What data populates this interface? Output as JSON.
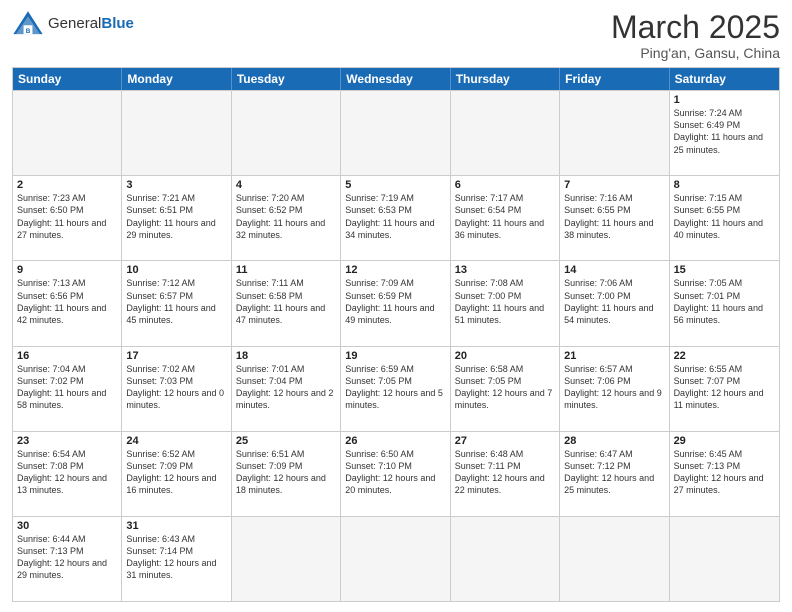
{
  "header": {
    "logo_general": "General",
    "logo_blue": "Blue",
    "month_title": "March 2025",
    "subtitle": "Ping'an, Gansu, China"
  },
  "weekdays": [
    "Sunday",
    "Monday",
    "Tuesday",
    "Wednesday",
    "Thursday",
    "Friday",
    "Saturday"
  ],
  "rows": [
    [
      {
        "day": "",
        "text": ""
      },
      {
        "day": "",
        "text": ""
      },
      {
        "day": "",
        "text": ""
      },
      {
        "day": "",
        "text": ""
      },
      {
        "day": "",
        "text": ""
      },
      {
        "day": "",
        "text": ""
      },
      {
        "day": "1",
        "text": "Sunrise: 7:24 AM\nSunset: 6:49 PM\nDaylight: 11 hours and 25 minutes."
      }
    ],
    [
      {
        "day": "2",
        "text": "Sunrise: 7:23 AM\nSunset: 6:50 PM\nDaylight: 11 hours and 27 minutes."
      },
      {
        "day": "3",
        "text": "Sunrise: 7:21 AM\nSunset: 6:51 PM\nDaylight: 11 hours and 29 minutes."
      },
      {
        "day": "4",
        "text": "Sunrise: 7:20 AM\nSunset: 6:52 PM\nDaylight: 11 hours and 32 minutes."
      },
      {
        "day": "5",
        "text": "Sunrise: 7:19 AM\nSunset: 6:53 PM\nDaylight: 11 hours and 34 minutes."
      },
      {
        "day": "6",
        "text": "Sunrise: 7:17 AM\nSunset: 6:54 PM\nDaylight: 11 hours and 36 minutes."
      },
      {
        "day": "7",
        "text": "Sunrise: 7:16 AM\nSunset: 6:55 PM\nDaylight: 11 hours and 38 minutes."
      },
      {
        "day": "8",
        "text": "Sunrise: 7:15 AM\nSunset: 6:55 PM\nDaylight: 11 hours and 40 minutes."
      }
    ],
    [
      {
        "day": "9",
        "text": "Sunrise: 7:13 AM\nSunset: 6:56 PM\nDaylight: 11 hours and 42 minutes."
      },
      {
        "day": "10",
        "text": "Sunrise: 7:12 AM\nSunset: 6:57 PM\nDaylight: 11 hours and 45 minutes."
      },
      {
        "day": "11",
        "text": "Sunrise: 7:11 AM\nSunset: 6:58 PM\nDaylight: 11 hours and 47 minutes."
      },
      {
        "day": "12",
        "text": "Sunrise: 7:09 AM\nSunset: 6:59 PM\nDaylight: 11 hours and 49 minutes."
      },
      {
        "day": "13",
        "text": "Sunrise: 7:08 AM\nSunset: 7:00 PM\nDaylight: 11 hours and 51 minutes."
      },
      {
        "day": "14",
        "text": "Sunrise: 7:06 AM\nSunset: 7:00 PM\nDaylight: 11 hours and 54 minutes."
      },
      {
        "day": "15",
        "text": "Sunrise: 7:05 AM\nSunset: 7:01 PM\nDaylight: 11 hours and 56 minutes."
      }
    ],
    [
      {
        "day": "16",
        "text": "Sunrise: 7:04 AM\nSunset: 7:02 PM\nDaylight: 11 hours and 58 minutes."
      },
      {
        "day": "17",
        "text": "Sunrise: 7:02 AM\nSunset: 7:03 PM\nDaylight: 12 hours and 0 minutes."
      },
      {
        "day": "18",
        "text": "Sunrise: 7:01 AM\nSunset: 7:04 PM\nDaylight: 12 hours and 2 minutes."
      },
      {
        "day": "19",
        "text": "Sunrise: 6:59 AM\nSunset: 7:05 PM\nDaylight: 12 hours and 5 minutes."
      },
      {
        "day": "20",
        "text": "Sunrise: 6:58 AM\nSunset: 7:05 PM\nDaylight: 12 hours and 7 minutes."
      },
      {
        "day": "21",
        "text": "Sunrise: 6:57 AM\nSunset: 7:06 PM\nDaylight: 12 hours and 9 minutes."
      },
      {
        "day": "22",
        "text": "Sunrise: 6:55 AM\nSunset: 7:07 PM\nDaylight: 12 hours and 11 minutes."
      }
    ],
    [
      {
        "day": "23",
        "text": "Sunrise: 6:54 AM\nSunset: 7:08 PM\nDaylight: 12 hours and 13 minutes."
      },
      {
        "day": "24",
        "text": "Sunrise: 6:52 AM\nSunset: 7:09 PM\nDaylight: 12 hours and 16 minutes."
      },
      {
        "day": "25",
        "text": "Sunrise: 6:51 AM\nSunset: 7:09 PM\nDaylight: 12 hours and 18 minutes."
      },
      {
        "day": "26",
        "text": "Sunrise: 6:50 AM\nSunset: 7:10 PM\nDaylight: 12 hours and 20 minutes."
      },
      {
        "day": "27",
        "text": "Sunrise: 6:48 AM\nSunset: 7:11 PM\nDaylight: 12 hours and 22 minutes."
      },
      {
        "day": "28",
        "text": "Sunrise: 6:47 AM\nSunset: 7:12 PM\nDaylight: 12 hours and 25 minutes."
      },
      {
        "day": "29",
        "text": "Sunrise: 6:45 AM\nSunset: 7:13 PM\nDaylight: 12 hours and 27 minutes."
      }
    ],
    [
      {
        "day": "30",
        "text": "Sunrise: 6:44 AM\nSunset: 7:13 PM\nDaylight: 12 hours and 29 minutes."
      },
      {
        "day": "31",
        "text": "Sunrise: 6:43 AM\nSunset: 7:14 PM\nDaylight: 12 hours and 31 minutes."
      },
      {
        "day": "",
        "text": ""
      },
      {
        "day": "",
        "text": ""
      },
      {
        "day": "",
        "text": ""
      },
      {
        "day": "",
        "text": ""
      },
      {
        "day": "",
        "text": ""
      }
    ]
  ]
}
